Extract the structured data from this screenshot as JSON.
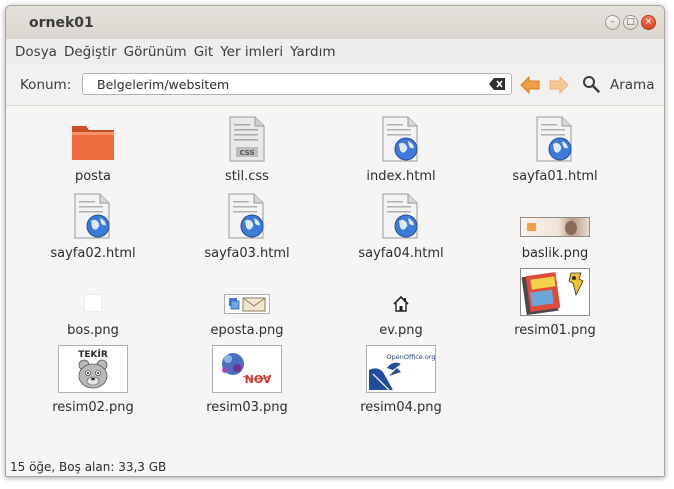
{
  "window": {
    "title": "ornek01"
  },
  "menu": [
    "Dosya",
    "Değiştir",
    "Görünüm",
    "Git",
    "Yer imleri",
    "Yardım"
  ],
  "toolbar": {
    "location_label": "Konum:",
    "location_value": "Belgelerim/websitem",
    "search_label": "Arama"
  },
  "files": [
    {
      "name": "posta",
      "icon": "folder-icon"
    },
    {
      "name": "stil.css",
      "icon": "css-file-icon"
    },
    {
      "name": "index.html",
      "icon": "html-file-icon"
    },
    {
      "name": "sayfa01.html",
      "icon": "html-file-icon"
    },
    {
      "name": "sayfa02.html",
      "icon": "html-file-icon"
    },
    {
      "name": "sayfa03.html",
      "icon": "html-file-icon"
    },
    {
      "name": "sayfa04.html",
      "icon": "html-file-icon"
    },
    {
      "name": "baslik.png",
      "icon": "image-thumbnail"
    },
    {
      "name": "bos.png",
      "icon": "image-thumbnail"
    },
    {
      "name": "eposta.png",
      "icon": "image-thumbnail"
    },
    {
      "name": "ev.png",
      "icon": "image-thumbnail"
    },
    {
      "name": "resim01.png",
      "icon": "image-thumbnail"
    },
    {
      "name": "resim02.png",
      "icon": "image-thumbnail"
    },
    {
      "name": "resim03.png",
      "icon": "image-thumbnail"
    },
    {
      "name": "resim04.png",
      "icon": "image-thumbnail"
    }
  ],
  "thumb_text": {
    "css_tag": "CSS",
    "tekir": "TEKİR",
    "nov": "NOV",
    "openoffice": "OpenOffice.org"
  },
  "status": {
    "text": "15 öğe, Boş alan: 33,3 GB"
  },
  "colors": {
    "folder": "#e8643a",
    "accent_arrow": "#f0a040",
    "close_button": "#e05a30"
  }
}
